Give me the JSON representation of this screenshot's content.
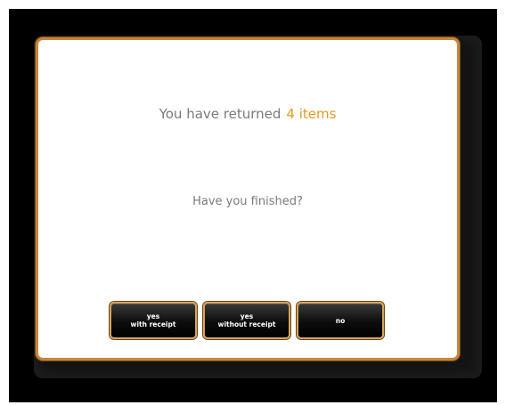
{
  "message": {
    "returned_prefix": "You have returned",
    "returned_count": "4 items",
    "question": "Have you finished?"
  },
  "buttons": [
    {
      "line1": "yes",
      "line2": "with receipt"
    },
    {
      "line1": "yes",
      "line2": "without receipt"
    },
    {
      "line1": "no",
      "line2": ""
    }
  ],
  "colors": {
    "accent": "#e39a1f",
    "border": "#c8853a",
    "button_bg": "#0d0d0d",
    "text_muted": "#7a7a7a"
  }
}
